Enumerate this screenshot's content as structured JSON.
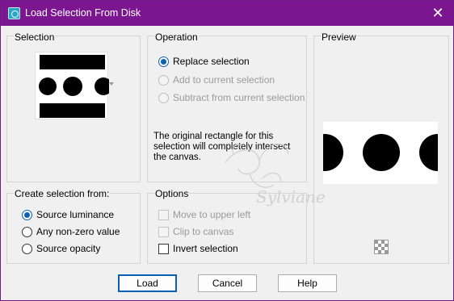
{
  "window": {
    "title": "Load Selection From Disk",
    "close_glyph": "✕"
  },
  "selection": {
    "label": "Selection"
  },
  "operation": {
    "label": "Operation",
    "options": [
      {
        "label": "Replace selection",
        "checked": true,
        "enabled": true
      },
      {
        "label": "Add to current selection",
        "checked": false,
        "enabled": false
      },
      {
        "label": "Subtract from current selection",
        "checked": false,
        "enabled": false
      }
    ],
    "message": "The original rectangle for this selection will completely intersect the canvas.",
    "message_lines": [
      "The original rectangle for this",
      "selection will completely intersect",
      "the canvas."
    ]
  },
  "preview": {
    "label": "Preview"
  },
  "create_from": {
    "label": "Create selection from:",
    "options": [
      {
        "label": "Source luminance",
        "checked": true
      },
      {
        "label": "Any non-zero value",
        "checked": false
      },
      {
        "label": "Source opacity",
        "checked": false
      }
    ]
  },
  "options": {
    "label": "Options",
    "items": [
      {
        "label": "Move to upper left",
        "checked": false,
        "enabled": false
      },
      {
        "label": "Clip to canvas",
        "checked": false,
        "enabled": false
      },
      {
        "label": "Invert selection",
        "checked": false,
        "enabled": true
      }
    ]
  },
  "buttons": {
    "load": "Load",
    "cancel": "Cancel",
    "help": "Help"
  },
  "watermark": {
    "text": "Sylviane"
  },
  "colors": {
    "titlebar": "#7b1690",
    "accent": "#0a5fb4"
  }
}
